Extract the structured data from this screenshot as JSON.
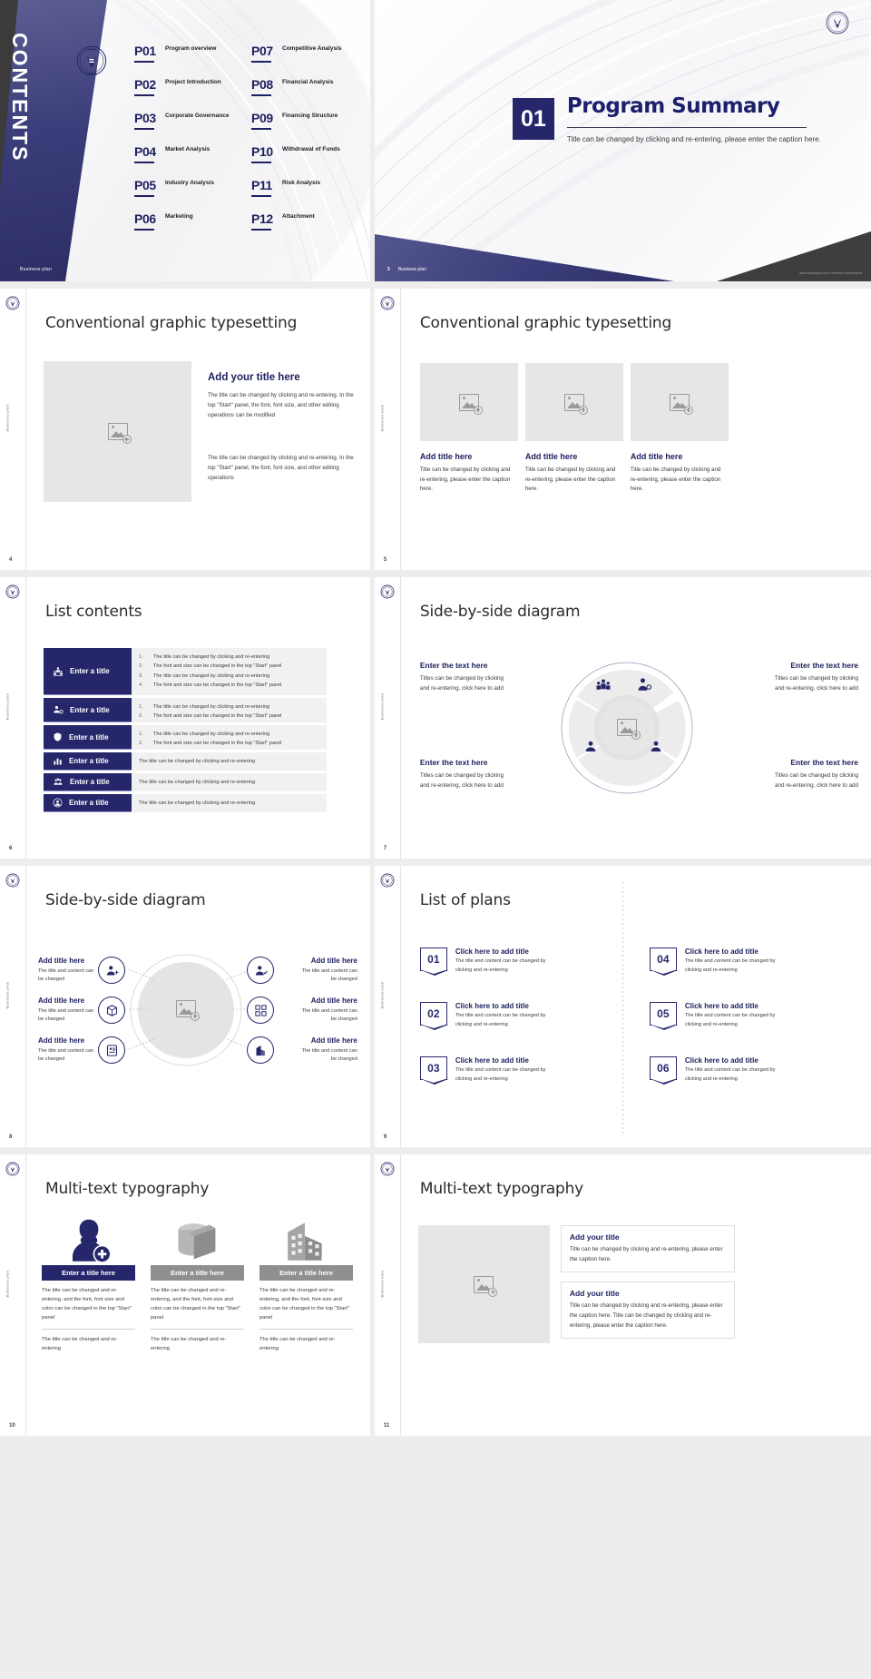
{
  "theme": {
    "navy": "#26276b",
    "navy_dark": "#1e2060",
    "grey": "#8f8f8f",
    "dark": "#3b3b3b"
  },
  "slide1": {
    "name": "contents-slide",
    "contents_word": "CONTENTS",
    "footer": "Business plan",
    "left_items": [
      {
        "num": "P01",
        "label": "Program overview"
      },
      {
        "num": "P02",
        "label": "Project Introduction"
      },
      {
        "num": "P03",
        "label": "Corporate Governance"
      },
      {
        "num": "P04",
        "label": "Market Analysis"
      },
      {
        "num": "P05",
        "label": "Industry Analysis"
      },
      {
        "num": "P06",
        "label": "Marketing"
      }
    ],
    "right_items": [
      {
        "num": "P07",
        "label": "Competitive Analysis"
      },
      {
        "num": "P08",
        "label": "Financial Analysis"
      },
      {
        "num": "P09",
        "label": "Financing Structure"
      },
      {
        "num": "P10",
        "label": "Withdrawal of Funds"
      },
      {
        "num": "P11",
        "label": "Risk Analysis"
      },
      {
        "num": "P12",
        "label": "Attachment"
      }
    ]
  },
  "slide2": {
    "name": "program-summary-slide",
    "number": "01",
    "title": "Program Summary",
    "subtitle": "Title can be changed by clicking and re-entering, please enter the caption here.",
    "page": "3",
    "footer": "Business plan",
    "footer_right": "www.tukepppt.com Internal information"
  },
  "slide4": {
    "name": "conventional-graphic-typesetting-slide-4",
    "title": "Conventional graphic typesetting",
    "side_label": "Business plan",
    "page": "4",
    "heading": "Add your title here",
    "paragraph1": "The title can be changed by clicking and re-entering. In the top \"Start\" panel, the font, font size, and other editing operations can be modified",
    "paragraph2": "The title can be changed by clicking and re-entering. In the top \"Start\" panel, the font, font size, and other editing operations"
  },
  "slide5": {
    "name": "conventional-graphic-typesetting-slide-5",
    "title": "Conventional graphic typesetting",
    "side_label": "Business plan",
    "page": "5",
    "columns": [
      {
        "heading": "Add title here",
        "text": "Title can be changed by clicking and re-entering, please enter the caption here."
      },
      {
        "heading": "Add title here",
        "text": "Title can be changed by clicking and re-entering, please enter the caption here."
      },
      {
        "heading": "Add title here",
        "text": "Title can be changed by clicking and re-entering, please enter the caption here."
      }
    ]
  },
  "slide6": {
    "name": "list-contents-slide",
    "title": "List contents",
    "side_label": "Business plan",
    "page": "6",
    "rows": [
      {
        "tab": "Enter a title",
        "icon": "team-icon",
        "bullets": [
          "The title can be changed by clicking and re-entering",
          "The font and size can be changed in the top \"Start\" panel",
          "The title can be changed by clicking and re-entering",
          "The font and size can be changed in the top \"Start\" panel"
        ]
      },
      {
        "tab": "Enter a title",
        "icon": "person-gear-icon",
        "bullets": [
          "The title can be changed by clicking and re-entering",
          "The font and size can be changed in the top \"Start\" panel"
        ]
      },
      {
        "tab": "Enter a title",
        "icon": "shield-icon",
        "bullets": [
          "The title can be changed by clicking and re-entering",
          "The font and size can be changed in the top \"Start\" panel"
        ]
      },
      {
        "tab": "Enter a title",
        "icon": "chart-icon",
        "bullets": [
          "The title can be changed by clicking and re-entering"
        ]
      },
      {
        "tab": "Enter a title",
        "icon": "group-icon",
        "bullets": [
          "The title can be changed by clicking and re-entering"
        ]
      },
      {
        "tab": "Enter a title",
        "icon": "user-circle-icon",
        "bullets": [
          "The title can be changed by clicking and re-entering"
        ]
      }
    ]
  },
  "slide7": {
    "name": "side-by-side-diagram-slide-7",
    "title": "Side-by-side diagram",
    "side_label": "Business plan",
    "page": "7",
    "blocks": [
      {
        "heading": "Enter the text here",
        "text": "Titles can be changed by clicking and re-entering, click here to add",
        "align": "left"
      },
      {
        "heading": "Enter the text here",
        "text": "Titles can be changed by clicking and re-entering, click here to add",
        "align": "right"
      },
      {
        "heading": "Enter the text here",
        "text": "Titles can be changed by clicking and re-entering, click here to add",
        "align": "left"
      },
      {
        "heading": "Enter the text here",
        "text": "Titles can be changed by clicking and re-entering, click here to add",
        "align": "right"
      }
    ]
  },
  "slide8": {
    "name": "side-by-side-diagram-slide-8",
    "title": "Side-by-side diagram",
    "side_label": "Business plan",
    "page": "8",
    "blocks": [
      {
        "heading": "Add title here",
        "text": "The title and content can be changed",
        "icon": "person-add-icon"
      },
      {
        "heading": "Add title here",
        "text": "The title and content can be changed",
        "icon": "cube-icon"
      },
      {
        "heading": "Add title here",
        "text": "The title and content can be changed",
        "icon": "id-card-icon"
      },
      {
        "heading": "Add title here",
        "text": "The title and content can be changed",
        "icon": "user-check-icon"
      },
      {
        "heading": "Add title here",
        "text": "The title and content can be changed",
        "icon": "network-icon"
      },
      {
        "heading": "Add title here",
        "text": "The title and content can be changed",
        "icon": "building-icon"
      }
    ]
  },
  "slide9": {
    "name": "list-of-plans-slide",
    "title": "List of plans",
    "side_label": "Business plan",
    "page": "9",
    "items": [
      {
        "num": "01",
        "heading": "Click here to add title",
        "text": "The title and content can be changed by clicking and re-entering"
      },
      {
        "num": "02",
        "heading": "Click here to add title",
        "text": "The title and content can be changed by clicking and re-entering"
      },
      {
        "num": "03",
        "heading": "Click here to add title",
        "text": "The title and content can be changed by clicking and re-entering"
      },
      {
        "num": "04",
        "heading": "Click here to add title",
        "text": "The title and content can be changed by clicking and re-entering"
      },
      {
        "num": "05",
        "heading": "Click here to add title",
        "text": "The title and content can be changed by clicking and re-entering"
      },
      {
        "num": "06",
        "heading": "Click here to add title",
        "text": "The title and content can be changed by clicking and re-entering"
      }
    ]
  },
  "slide10": {
    "name": "multi-text-typography-slide-10",
    "title": "Multi-text typography",
    "side_label": "Business plan",
    "page": "10",
    "columns": [
      {
        "icon": "woman-add-icon",
        "bar": "Enter a title here",
        "bar_style": "navy",
        "p1": "The title can be changed and re-entering, and the font, font size and color can be changed in the top \"Start\" panel",
        "p2": "The title can be changed and re-entering"
      },
      {
        "icon": "cylinder-box-icon",
        "bar": "Enter a title here",
        "bar_style": "grey",
        "p1": "The title can be changed and re-entering, and the font, font size and color can be changed in the top \"Start\" panel",
        "p2": "The title can be changed and re-entering"
      },
      {
        "icon": "building-icon",
        "bar": "Enter a title here",
        "bar_style": "grey",
        "p1": "The title can be changed and re-entering, and the font, font size and color can be changed in the top \"Start\" panel",
        "p2": "The title can be changed and re-entering"
      }
    ]
  },
  "slide11": {
    "name": "multi-text-typography-slide-11",
    "title": "Multi-text typography",
    "side_label": "Business plan",
    "page": "11",
    "cards": [
      {
        "heading": "Add your title",
        "text": "Title can be changed by clicking and re-entering, please enter the caption here."
      },
      {
        "heading": "Add your title",
        "text": "Title can be changed by clicking and re-entering, please enter the caption here. Title can be changed by clicking and re-entering, please enter the caption here."
      }
    ]
  }
}
